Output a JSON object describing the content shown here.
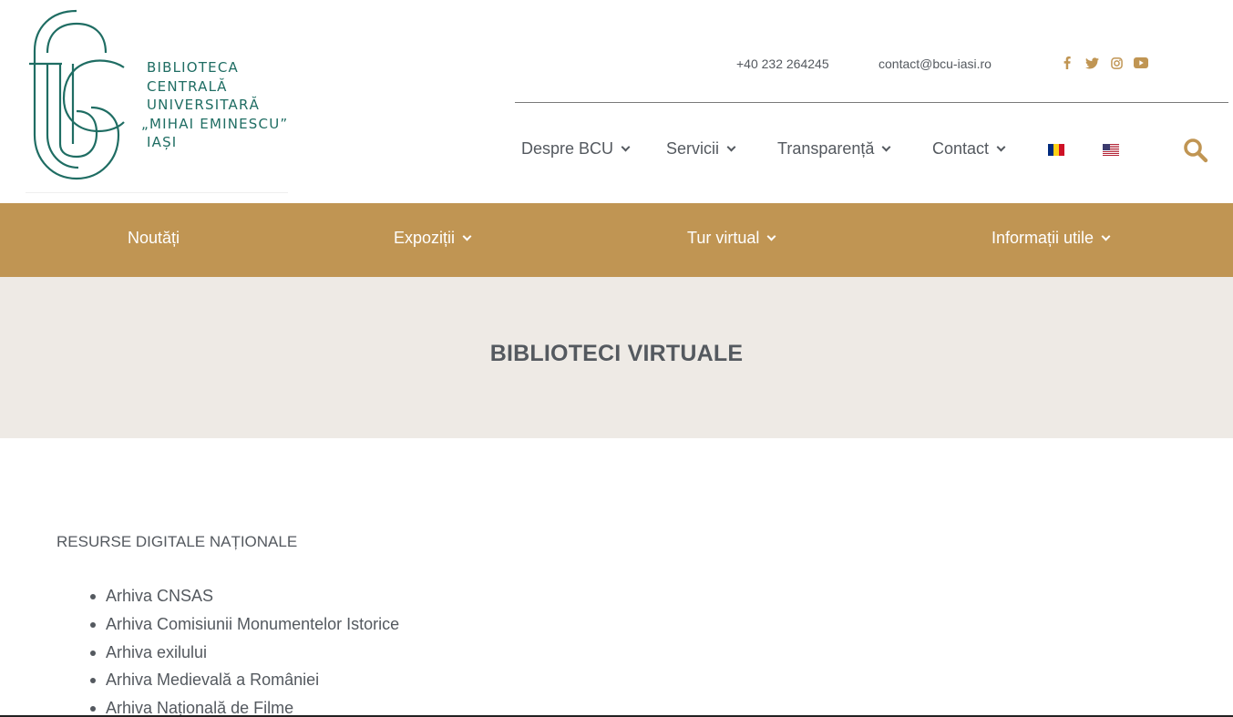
{
  "logo": {
    "lines": [
      "BIBLIOTECA",
      "CENTRALĂ",
      "UNIVERSITARĂ",
      "„MIHAI EMINESCU”",
      "IAȘI"
    ]
  },
  "topbar": {
    "phone": "+40 232 264245",
    "email": "contact@bcu-iasi.ro",
    "social": [
      "facebook-icon",
      "twitter-icon",
      "instagram-icon",
      "youtube-icon"
    ]
  },
  "mainnav": {
    "items": [
      {
        "label": "Despre BCU"
      },
      {
        "label": "Servicii"
      },
      {
        "label": "Transparență"
      },
      {
        "label": "Contact"
      }
    ],
    "languages": [
      "romanian-flag-icon",
      "us-flag-icon"
    ]
  },
  "goldnav": {
    "items": [
      {
        "label": "Noutăți"
      },
      {
        "label": "Expoziții"
      },
      {
        "label": "Tur virtual"
      },
      {
        "label": "Informații utile"
      }
    ]
  },
  "page": {
    "title": "BIBLIOTECI VIRTUALE",
    "section_heading": "RESURSE DIGITALE NAȚIONALE",
    "resources": [
      "Arhiva CNSAS",
      "Arhiva Comisiunii Monumentelor Istorice",
      "Arhiva exilului",
      "Arhiva Medievală a României",
      "Arhiva Națională de Filme"
    ]
  },
  "colors": {
    "brand_green": "#1f6d63",
    "gold": "#c09553",
    "title_band": "#eeeae5",
    "text": "#54595f"
  }
}
